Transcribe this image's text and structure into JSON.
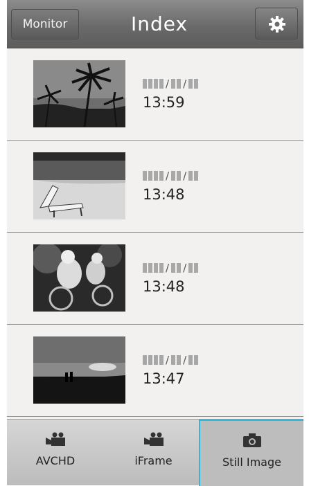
{
  "header": {
    "monitor_label": "Monitor",
    "title": "Index",
    "settings_icon": "gear-icon"
  },
  "items": [
    {
      "date": "████/██/██",
      "time": "13:59",
      "thumbnail": "palm-trees-photo"
    },
    {
      "date": "████/██/██",
      "time": "13:48",
      "thumbnail": "beach-chair-photo"
    },
    {
      "date": "████/██/██",
      "time": "13:48",
      "thumbnail": "cyclists-photo"
    },
    {
      "date": "████/██/██",
      "time": "13:47",
      "thumbnail": "sunset-beach-photo"
    }
  ],
  "tabs": [
    {
      "label": "AVCHD",
      "icon": "video-camera-icon"
    },
    {
      "label": "iFrame",
      "icon": "video-camera-icon"
    },
    {
      "label": "Still Image",
      "icon": "camera-icon",
      "selected": true
    }
  ],
  "colors": {
    "header": "#6a6a6a",
    "list_bg": "#f3f1ef",
    "selection_outline": "#33b6d9"
  }
}
